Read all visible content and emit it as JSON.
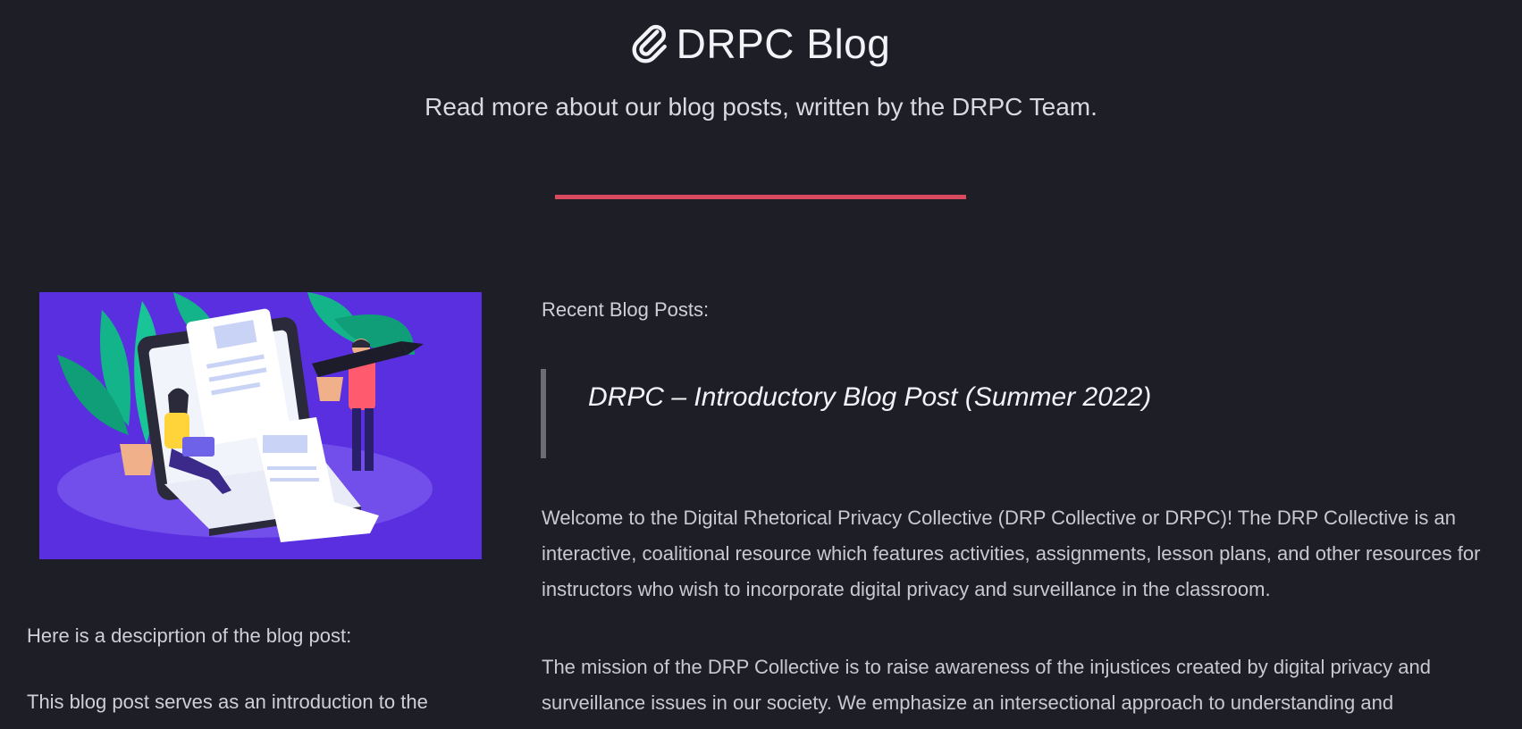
{
  "header": {
    "title": "DRPC Blog",
    "title_icon": "paperclip-icon",
    "subtitle": "Read more about our blog posts, written by the DRPC Team."
  },
  "colors": {
    "background": "#1e1e27",
    "accent_divider": "#d94a5e",
    "hero_background": "#5a2fe0"
  },
  "left": {
    "description_label": "Here is a desciprtion of the blog post:",
    "description_text": "This blog post serves as an introduction to the"
  },
  "right": {
    "recent_label": "Recent Blog Posts:",
    "post_title": "DRPC – Introductory Blog Post (Summer 2022)",
    "paragraph1": "Welcome to the Digital Rhetorical Privacy Collective (DRP Collective or DRPC)! The DRP Collective is an interactive, coalitional resource which features activities, assignments, lesson plans, and other resources for instructors who wish to incorporate digital privacy and surveillance in the classroom.",
    "paragraph2": "The mission of the DRP Collective is to raise awareness of the injustices created by digital privacy and surveillance issues in our society. We emphasize an intersectional approach to understanding and"
  }
}
